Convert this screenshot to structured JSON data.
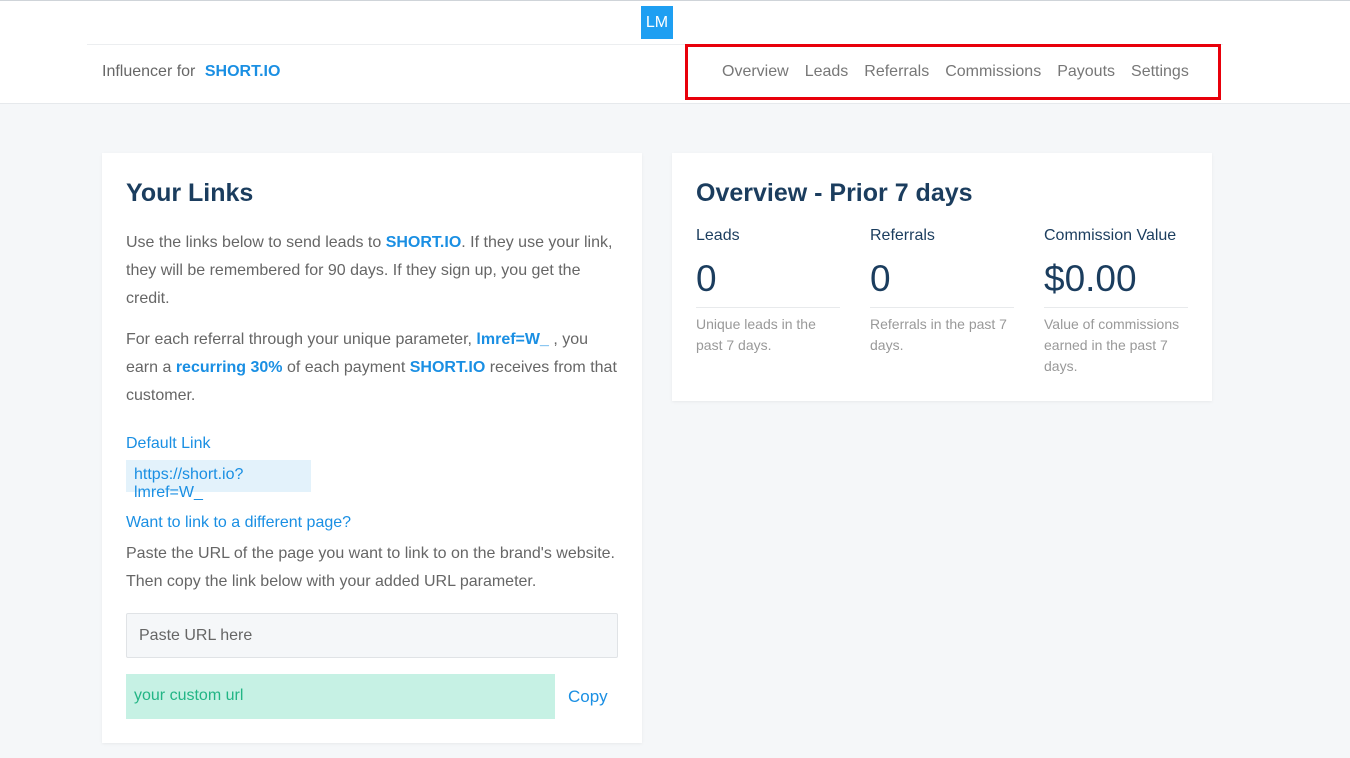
{
  "header": {
    "avatar_initials": "LM",
    "brand_prefix": "Influencer for",
    "brand_name": "SHORT.IO",
    "nav": [
      "Overview",
      "Leads",
      "Referrals",
      "Commissions",
      "Payouts",
      "Settings"
    ]
  },
  "links_card": {
    "title": "Your Links",
    "intro_part1": "Use the links below to send leads to ",
    "intro_brand": "SHORT.IO",
    "intro_part2": ". If they use your link, they will be remembered for 90 days. If they sign up, you get the credit.",
    "referral_part1": "For each referral through your unique parameter, ",
    "referral_param": "lmref=W_",
    "referral_part2": " , you earn a ",
    "referral_rate": "recurring 30%",
    "referral_part3": " of each payment ",
    "referral_brand": "SHORT.IO",
    "referral_part4": " receives from that customer.",
    "default_link_label": "Default Link",
    "default_link_value": "https://short.io?lmref=W_",
    "different_page_label": "Want to link to a different page?",
    "different_page_text": "Paste the URL of the page you want to link to on the brand's website. Then copy the link below with your added URL parameter.",
    "url_input_placeholder": "Paste URL here",
    "custom_url_placeholder": "your custom url",
    "copy_label": "Copy"
  },
  "overview_card": {
    "title": "Overview - Prior 7 days",
    "stats": [
      {
        "label": "Leads",
        "value": "0",
        "desc": "Unique leads in the past 7 days."
      },
      {
        "label": "Referrals",
        "value": "0",
        "desc": "Referrals in the past 7 days."
      },
      {
        "label": "Commission Value",
        "value": "$0.00",
        "desc": "Value of commissions earned in the past 7 days."
      }
    ]
  },
  "colors": {
    "accent": "#1a8fe3",
    "title": "#1b3d5e",
    "highlight_box": "#e8000b",
    "custom_url_bg": "#c6f1e4"
  }
}
